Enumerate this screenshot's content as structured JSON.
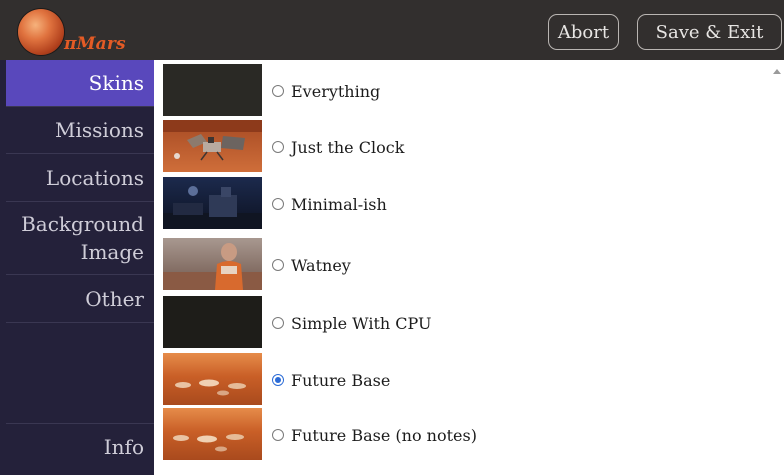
{
  "header": {
    "app_name": "πMars",
    "abort_label": "Abort",
    "save_exit_label": "Save & Exit"
  },
  "sidebar": {
    "items": [
      {
        "label": "Skins",
        "active": true
      },
      {
        "label": "Missions"
      },
      {
        "label": "Locations"
      },
      {
        "label": "Background",
        "label_line2": "Image"
      },
      {
        "label": "Other"
      }
    ],
    "info_label": "Info"
  },
  "skins": [
    {
      "label": "Everything",
      "selected": false,
      "thumb": "dark-panel"
    },
    {
      "label": "Just the Clock",
      "selected": false,
      "thumb": "lander-on-mars"
    },
    {
      "label": "Minimal-ish",
      "selected": false,
      "thumb": "night-base"
    },
    {
      "label": "Watney",
      "selected": false,
      "thumb": "astronaut-portrait"
    },
    {
      "label": "Simple With CPU",
      "selected": false,
      "thumb": "dark-panel"
    },
    {
      "label": "Future Base",
      "selected": true,
      "thumb": "mars-base"
    },
    {
      "label": "Future Base (no notes)",
      "selected": false,
      "thumb": "mars-base"
    }
  ],
  "colors": {
    "header_bg": "#322f2e",
    "sidebar_bg": "#24213a",
    "active_nav": "#5948bc",
    "logo_accent": "#e45b25",
    "radio_selected": "#2b6bd6"
  }
}
